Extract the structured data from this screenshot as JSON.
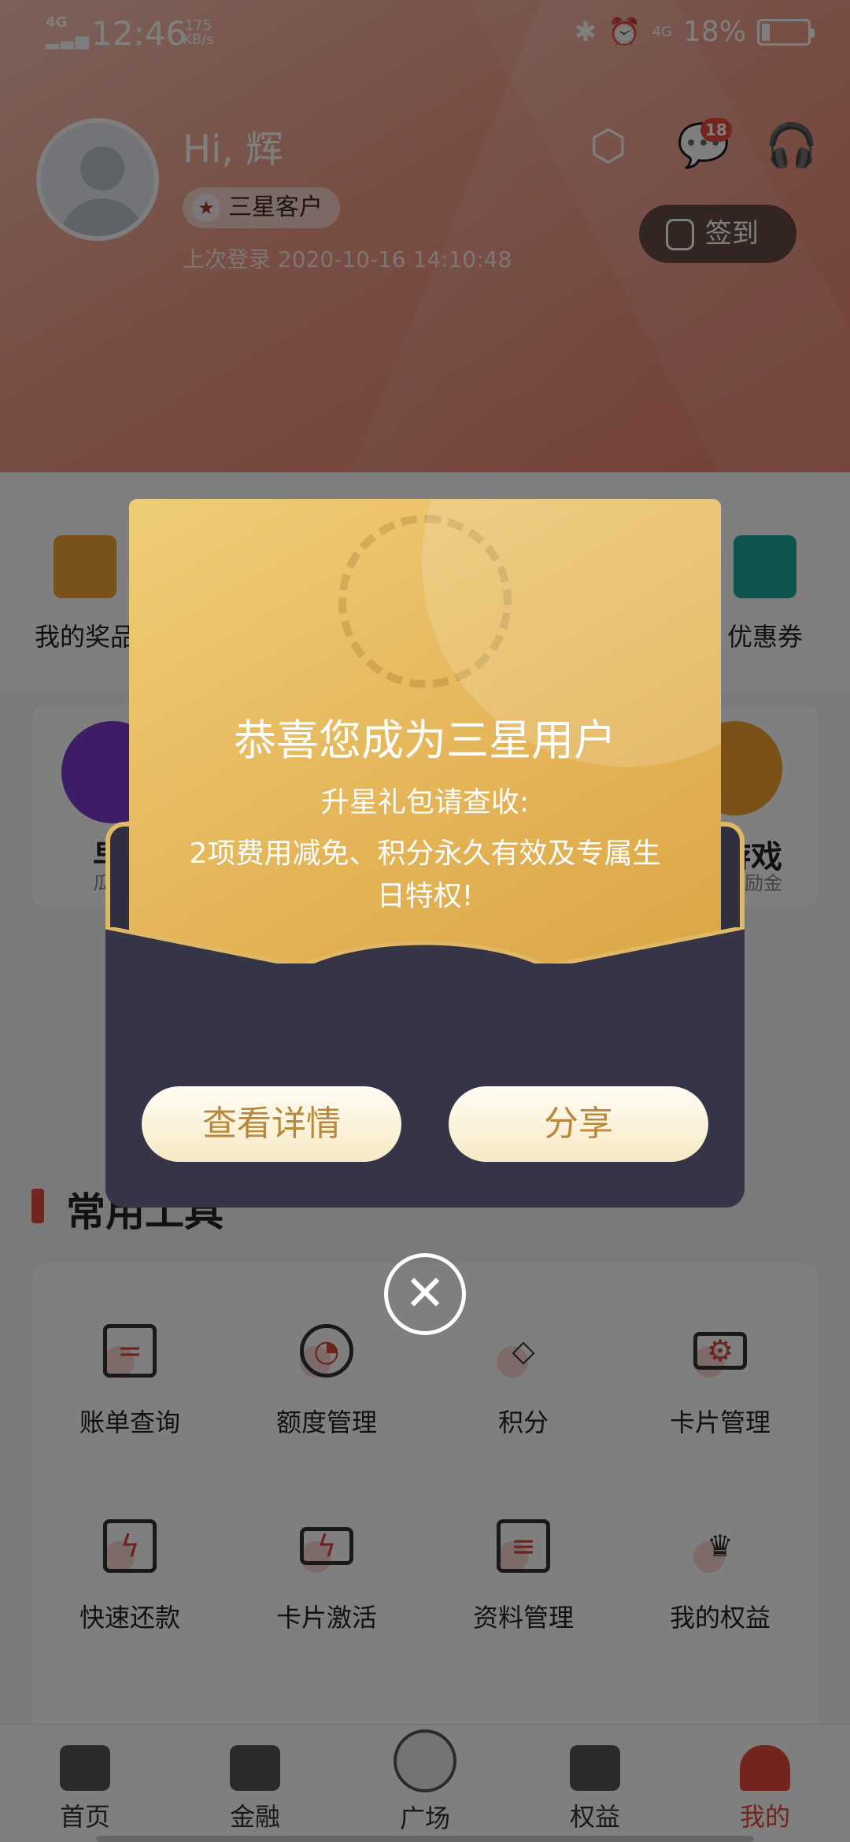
{
  "status_bar": {
    "network": "4G",
    "time": "12:46",
    "speed": "175",
    "speed_unit": "KB/s",
    "network2": "4G",
    "battery": "18%",
    "battery_level": 0.18
  },
  "profile": {
    "greeting": "Hi, 辉",
    "level": "三星客户",
    "last_login": "上次登录 2020-10-16 14:10:48",
    "message_count": "18",
    "checkin_label": "签到"
  },
  "quick_entries": [
    {
      "label": "我的奖品"
    },
    {
      "label": "优惠券"
    }
  ],
  "promos": [
    {
      "title": "早起",
      "subtitle": "瓜分"
    },
    {
      "title": "游戏",
      "subtitle": "领励金"
    }
  ],
  "section": {
    "title": "常用工具"
  },
  "tools": [
    {
      "label": "账单查询",
      "icon": "bill-icon"
    },
    {
      "label": "额度管理",
      "icon": "pie-chart-icon"
    },
    {
      "label": "积分",
      "icon": "diamond-icon"
    },
    {
      "label": "卡片管理",
      "icon": "card-settings-icon"
    },
    {
      "label": "快速还款",
      "icon": "lightning-icon"
    },
    {
      "label": "卡片激活",
      "icon": "card-activate-icon"
    },
    {
      "label": "资料管理",
      "icon": "book-icon"
    },
    {
      "label": "我的权益",
      "icon": "crown-icon"
    }
  ],
  "bottom_nav": [
    {
      "label": "首页",
      "icon": "home-icon"
    },
    {
      "label": "金融",
      "icon": "wallet-icon"
    },
    {
      "label": "广场",
      "icon": "mascot-icon"
    },
    {
      "label": "权益",
      "icon": "gift-icon"
    },
    {
      "label": "我的",
      "icon": "user-icon",
      "active": true
    }
  ],
  "modal": {
    "title": "恭喜您成为三星用户",
    "subtitle": "升星礼包请查收:",
    "description": "2项费用减免、积分永久有效及专属生日特权!",
    "detail_button": "查看详情",
    "share_button": "分享",
    "close": "✕"
  },
  "colors": {
    "accent": "#e5483b",
    "gold": "#e4b457",
    "envelope": "#353547"
  }
}
